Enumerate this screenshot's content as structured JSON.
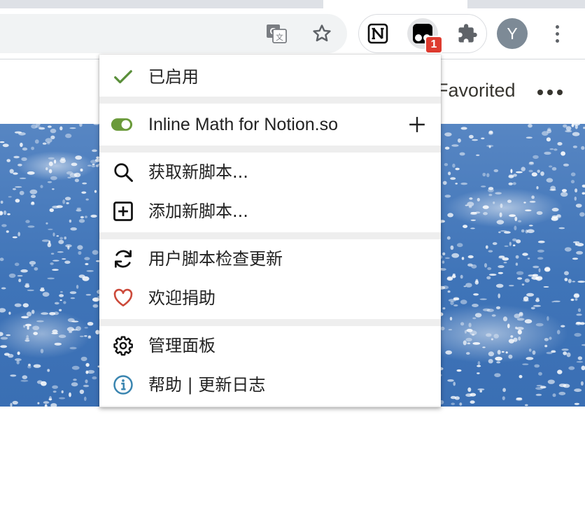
{
  "browser": {
    "profile_initial": "Y",
    "extension_badge_count": "1",
    "icons": {
      "translate": "google-translate-icon",
      "bookmark": "star-icon",
      "notion": "notion-icon",
      "tampermonkey": "tampermonkey-icon",
      "extensions": "puzzle-icon",
      "menu": "kebab-menu-icon"
    }
  },
  "page": {
    "favorited_label": "Favorited",
    "more_icon": "more-horizontal-icon"
  },
  "menu": {
    "status": {
      "label": "已启用",
      "icon": "check-icon",
      "color": "#5a8f3a"
    },
    "script": {
      "label": "Inline Math for Notion.so",
      "icon": "toggle-on-icon",
      "action_icon": "plus-icon",
      "enabled": true
    },
    "find_scripts": {
      "label": "获取新脚本...",
      "icon": "search-icon"
    },
    "add_script": {
      "label": "添加新脚本...",
      "icon": "plus-square-icon"
    },
    "check_updates": {
      "label": "用户脚本检查更新",
      "icon": "refresh-icon"
    },
    "donate": {
      "label": "欢迎捐助",
      "icon": "heart-icon",
      "color": "#cc4a3b"
    },
    "dashboard": {
      "label": "管理面板",
      "icon": "gear-icon"
    },
    "help": {
      "label": "帮助 | 更新日志",
      "icon": "info-icon",
      "color": "#3a85b0"
    }
  },
  "colors": {
    "toggle_on": "#6a9a3a",
    "badge": "#de3b2f",
    "avatar": "#7d8a96"
  }
}
